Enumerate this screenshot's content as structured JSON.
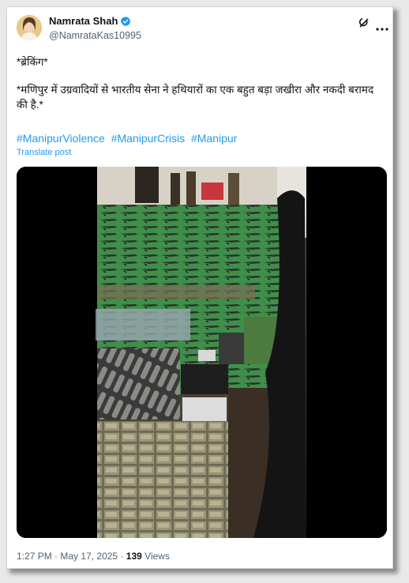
{
  "post": {
    "author_name": "Namrata Shah",
    "author_handle": "@NamrataKas10995",
    "line1": "*ब्रेकिंग*",
    "line2": "*मणिपुर में उग्रवादियों से भारतीय सेना ने हथियारों का एक बहुत बड़ा जखीरा और नकदी बरामद की है.*",
    "hashtags": [
      "#ManipurViolence",
      "#ManipurCrisis",
      "#Manipur"
    ],
    "translate_label": "Translate post",
    "time": "1:27 PM",
    "date": "May 17, 2025",
    "views_count": "139",
    "views_label": "Views",
    "separator": "·"
  },
  "colors": {
    "link": "#1d9bf0",
    "verified": "#1d9bf0",
    "muted": "#536471",
    "text": "#0f1419"
  },
  "icons": [
    "verified-badge-icon",
    "grok-icon",
    "more-options-icon"
  ]
}
